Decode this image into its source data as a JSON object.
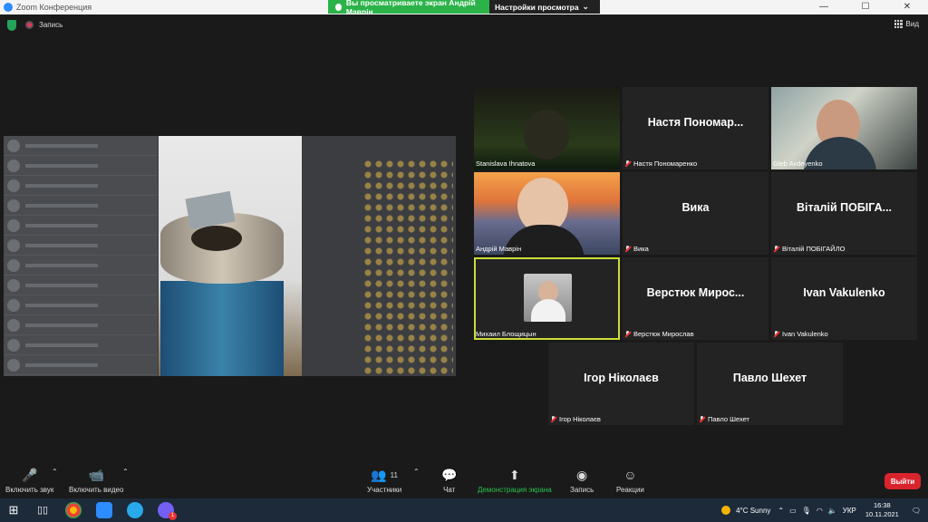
{
  "window": {
    "title": "Zoom Конференция",
    "controls": [
      "—",
      "☐",
      "✕"
    ]
  },
  "share_banner": {
    "viewing": "Вы просматриваете экран Андрій Маврін",
    "settings": "Настройки просмотра"
  },
  "topbar": {
    "record": "Запись",
    "view": "Вид"
  },
  "tiles": [
    {
      "id": "stanislava",
      "name": "Stanislava Ihnatova",
      "big": "",
      "muted": false
    },
    {
      "id": "nastya",
      "name": "Настя Пономаренко",
      "big": "Настя  Пономар...",
      "muted": true
    },
    {
      "id": "gleb",
      "name": "Gleb Avdeyenko",
      "big": "",
      "muted": false
    },
    {
      "id": "andriy",
      "name": "Андрій Маврін",
      "big": "",
      "muted": false
    },
    {
      "id": "vika",
      "name": "Вика",
      "big": "Вика",
      "muted": true
    },
    {
      "id": "vitaliy",
      "name": "Віталій ПОБІГАЙЛО",
      "big": "Віталій  ПОБІГА...",
      "muted": true
    },
    {
      "id": "mikhail",
      "name": "Михаил Блощицын",
      "big": "",
      "muted": false
    },
    {
      "id": "verstyuk",
      "name": "Верстюк Мирослав",
      "big": "Верстюк  Мирос...",
      "muted": true
    },
    {
      "id": "ivan",
      "name": "Ivan Vakulenko",
      "big": "Ivan Vakulenko",
      "muted": true
    },
    {
      "id": "igor",
      "name": "Ігор Ніколаєв",
      "big": "Ігор Ніколаєв",
      "muted": true
    },
    {
      "id": "pavlo",
      "name": "Павло Шехет",
      "big": "Павло Шехет",
      "muted": true
    }
  ],
  "toolbar": {
    "audio": "Включить звук",
    "video": "Включить видео",
    "participants": "Участники",
    "participants_count": "11",
    "chat": "Чат",
    "share": "Демонстрация экрана",
    "record": "Запись",
    "reactions": "Реакции",
    "leave": "Выйти"
  },
  "taskbar": {
    "weather": "4°C  Sunny",
    "lang": "УКР",
    "time": "16:38",
    "date": "10.11.2021",
    "viber_badge": "1"
  },
  "colors": {
    "accent_green": "#2bb34a",
    "leave_red": "#d9242e",
    "highlight": "#cddc39"
  }
}
